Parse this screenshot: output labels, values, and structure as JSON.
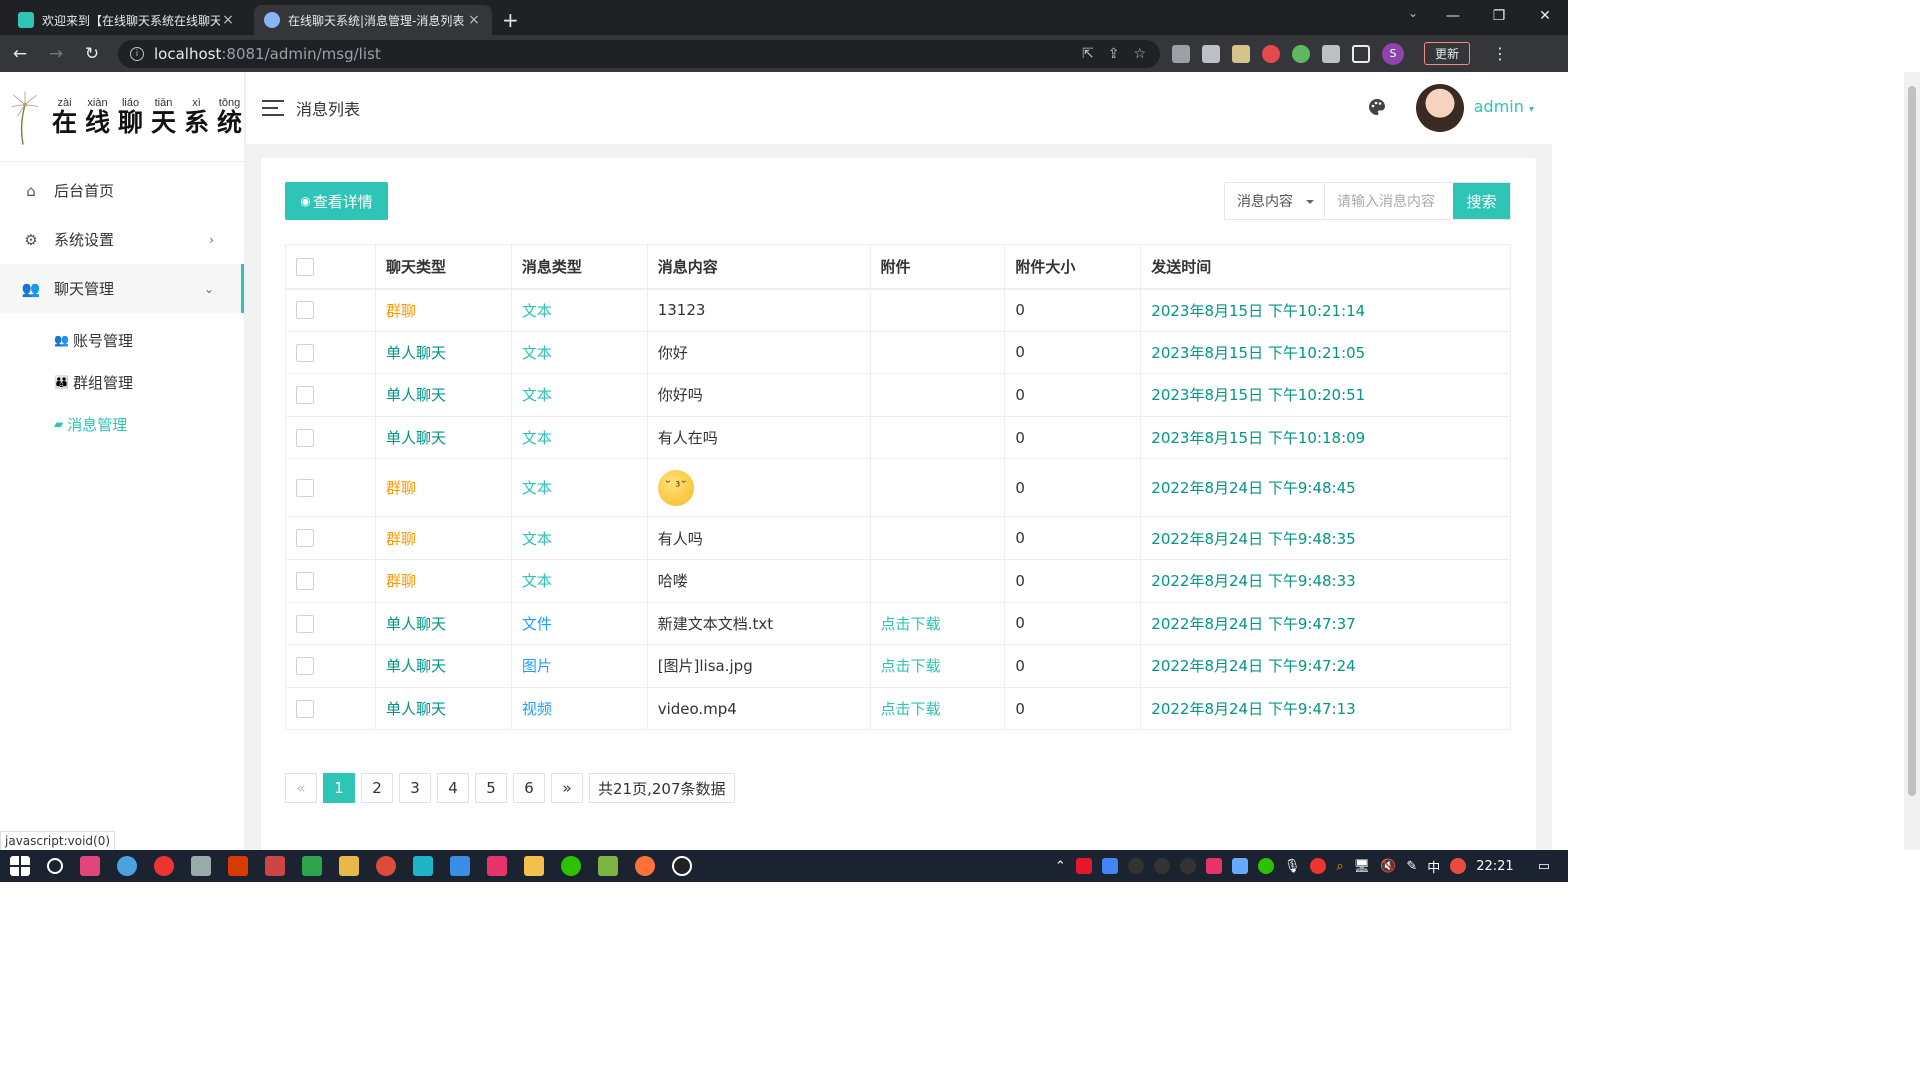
{
  "browser": {
    "tabs": [
      {
        "title": "欢迎来到【在线聊天系统在线聊天",
        "close": "×"
      },
      {
        "title": "在线聊天系统|消息管理-消息列表",
        "close": "×"
      }
    ],
    "new_tab": "+",
    "url_host": "localhost",
    "url_path": ":8081/admin/msg/list",
    "profile_letter": "S",
    "update_label": "更新"
  },
  "logo": {
    "pinyin": [
      "zài",
      "xiàn",
      "liáo",
      "tiān",
      "xì",
      "tǒng"
    ],
    "chars": [
      "在",
      "线",
      "聊",
      "天",
      "系",
      "统"
    ]
  },
  "sidebar": {
    "items": [
      {
        "label": "后台首页"
      },
      {
        "label": "系统设置"
      },
      {
        "label": "聊天管理"
      }
    ],
    "subitems": [
      {
        "label": "账号管理"
      },
      {
        "label": "群组管理"
      },
      {
        "label": "消息管理"
      }
    ]
  },
  "header": {
    "title": "消息列表",
    "username": "admin"
  },
  "toolbar": {
    "detail_label": "查看详情",
    "search_field": "消息内容",
    "search_placeholder": "请输入消息内容",
    "search_label": "搜索"
  },
  "table": {
    "headers": [
      "聊天类型",
      "消息类型",
      "消息内容",
      "附件",
      "附件大小",
      "发送时间"
    ],
    "rows": [
      {
        "chat": "群聊",
        "type": "文本",
        "content": "13123",
        "attach": "",
        "size": "0",
        "time": "2023年8月15日 下午10:21:14"
      },
      {
        "chat": "单人聊天",
        "type": "文本",
        "content": "你好",
        "attach": "",
        "size": "0",
        "time": "2023年8月15日 下午10:21:05"
      },
      {
        "chat": "单人聊天",
        "type": "文本",
        "content": "你好吗",
        "attach": "",
        "size": "0",
        "time": "2023年8月15日 下午10:20:51"
      },
      {
        "chat": "单人聊天",
        "type": "文本",
        "content": "有人在吗",
        "attach": "",
        "size": "0",
        "time": "2023年8月15日 下午10:18:09"
      },
      {
        "chat": "群聊",
        "type": "文本",
        "content": "",
        "attach": "",
        "size": "0",
        "time": "2022年8月24日 下午9:48:45"
      },
      {
        "chat": "群聊",
        "type": "文本",
        "content": "有人吗",
        "attach": "",
        "size": "0",
        "time": "2022年8月24日 下午9:48:35"
      },
      {
        "chat": "群聊",
        "type": "文本",
        "content": "哈喽",
        "attach": "",
        "size": "0",
        "time": "2022年8月24日 下午9:48:33"
      },
      {
        "chat": "单人聊天",
        "type": "文件",
        "content": "新建文本文档.txt",
        "attach": "点击下载",
        "size": "0",
        "time": "2022年8月24日 下午9:47:37"
      },
      {
        "chat": "单人聊天",
        "type": "图片",
        "content": "[图片]lisa.jpg",
        "attach": "点击下载",
        "size": "0",
        "time": "2022年8月24日 下午9:47:24"
      },
      {
        "chat": "单人聊天",
        "type": "视频",
        "content": "video.mp4",
        "attach": "点击下载",
        "size": "0",
        "time": "2022年8月24日 下午9:47:13"
      }
    ]
  },
  "pager": {
    "prev": "«",
    "pages": [
      "1",
      "2",
      "3",
      "4",
      "5",
      "6"
    ],
    "next": "»",
    "summary": "共21页,207条数据"
  },
  "statusbar": "javascript:void(0)",
  "taskbar": {
    "clock": "22:21",
    "ime": "中"
  },
  "colors": {
    "accent": "#2ec4b6",
    "group_chat": "#ff9800",
    "single_chat": "#009688",
    "time": "#009688",
    "link": "#1e9fff"
  }
}
